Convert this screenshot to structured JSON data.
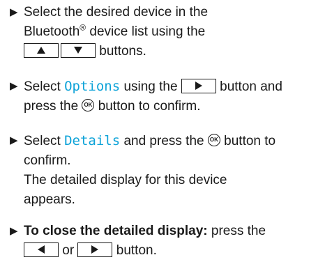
{
  "steps": [
    {
      "part1": "Select the desired device in the",
      "part2": "Bluetooth",
      "reg": "®",
      "part3": "device list using the",
      "part4": "buttons."
    },
    {
      "part1": "Select",
      "highlight": "Options",
      "part2": "using the",
      "part3": "button and",
      "part4": "press the",
      "part5": "button to confirm."
    },
    {
      "part1": "Select",
      "highlight": "Details",
      "part2": "and press the",
      "part3": "button to",
      "part4": "confirm.",
      "result1": "The detailed display for this device",
      "result2": "appears."
    },
    {
      "bold": "To close the detailed display:",
      "part1": "press the",
      "part2": "or",
      "part3": "button."
    }
  ],
  "ok_label": "OK",
  "bullet": "▶",
  "icons": [
    "up-arrow-button-icon",
    "down-arrow-button-icon",
    "right-arrow-button-icon",
    "left-arrow-button-icon",
    "ok-button-icon"
  ],
  "colors": {
    "highlight": "#0ea3d8",
    "text": "#1a1a1a"
  }
}
